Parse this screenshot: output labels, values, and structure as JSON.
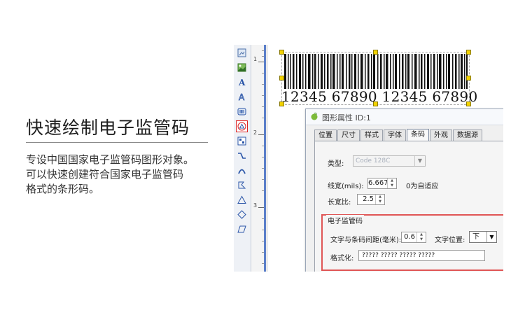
{
  "promo": {
    "headline": "快速绘制电子监管码",
    "desc_lines": [
      "专设中国国家电子监管码图形对象。",
      "可以快速创建符合国家电子监管码",
      "格式的条形码。"
    ]
  },
  "ruler": {
    "labels": [
      "1",
      "2",
      "3"
    ]
  },
  "barcode": {
    "text": "12345 67890 12345 67890"
  },
  "dialog": {
    "title": "图形属性 ID:1",
    "close_glyph": "✕",
    "tabs": [
      "位置",
      "尺寸",
      "样式",
      "字体",
      "条码",
      "外观",
      "数据源"
    ],
    "active_tab": "条码",
    "type_label": "类型:",
    "type_value": "Code 128C",
    "linewidth_label": "线宽(mils):",
    "linewidth_value": "6.667",
    "linewidth_hint": "0为自适应",
    "ratio_label": "长宽比:",
    "ratio_value": "2.5",
    "group_title": "电子监管码",
    "spacing_label": "文字与条码间距(毫米):",
    "spacing_value": "0.6",
    "textpos_label": "文字位置:",
    "textpos_value": "下",
    "format_label": "格式化:",
    "format_value": "????? ????? ????? ?????"
  },
  "colors": {
    "accent_red": "#e05555",
    "guide_blue": "#5b7fc9",
    "handle_yellow": "#f2d200"
  },
  "toolbar_icons": [
    "image-frame-icon",
    "picture-icon",
    "text-icon",
    "outline-text-icon",
    "barcode-icon",
    "supervision-code-icon",
    "qrcode-icon",
    "line-icon",
    "arc-icon",
    "polyline-icon",
    "triangle-icon",
    "diamond-icon",
    "parallelogram-icon"
  ]
}
